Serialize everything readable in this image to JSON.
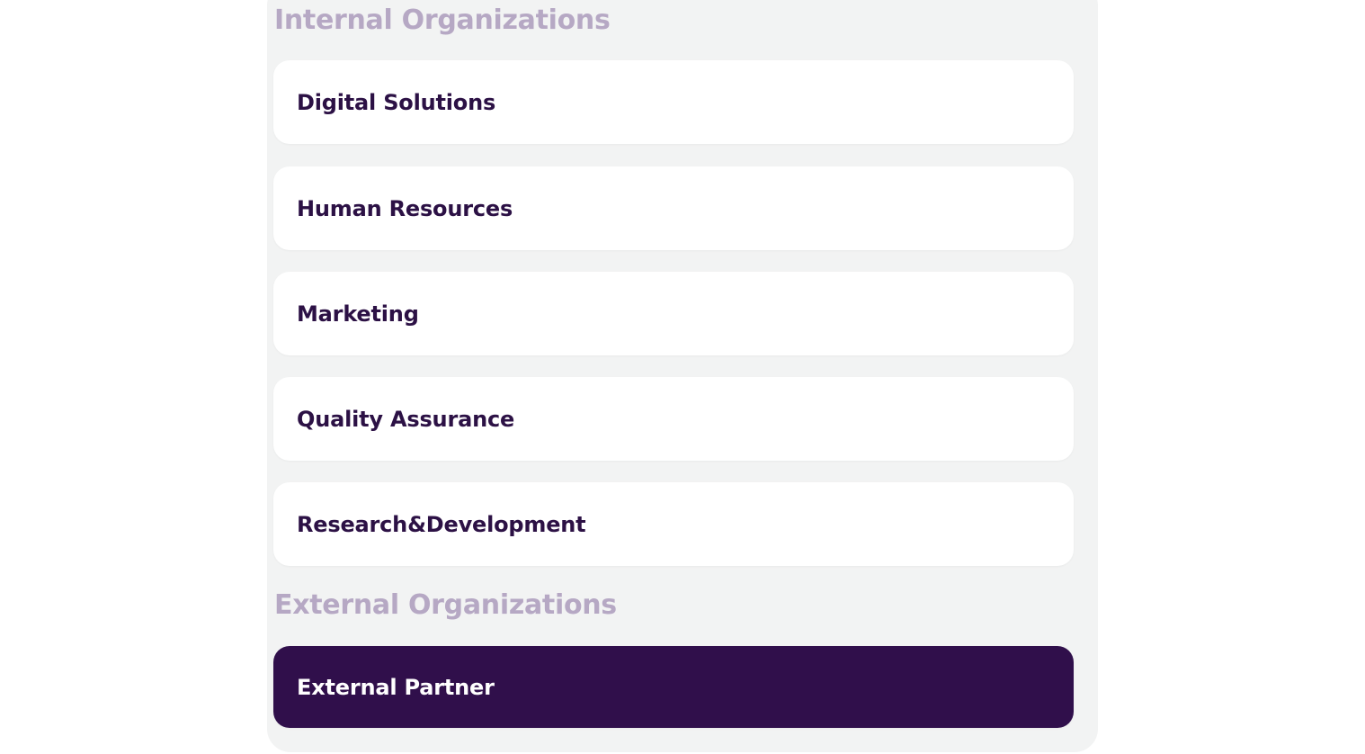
{
  "internal": {
    "heading": "Internal Organizations",
    "items": [
      {
        "label": "Digital Solutions"
      },
      {
        "label": "Human Resources"
      },
      {
        "label": "Marketing"
      },
      {
        "label": "Quality Assurance"
      },
      {
        "label": "Research&Development"
      }
    ]
  },
  "external": {
    "heading": "External Organizations",
    "items": [
      {
        "label": "External Partner",
        "selected": true
      }
    ]
  },
  "colors": {
    "heading": "#b6a8c4",
    "label": "#2c1145",
    "selected_background": "#300f4b",
    "selected_label": "#ffffff",
    "panel_background": "#f2f3f3",
    "card_background": "#ffffff"
  }
}
